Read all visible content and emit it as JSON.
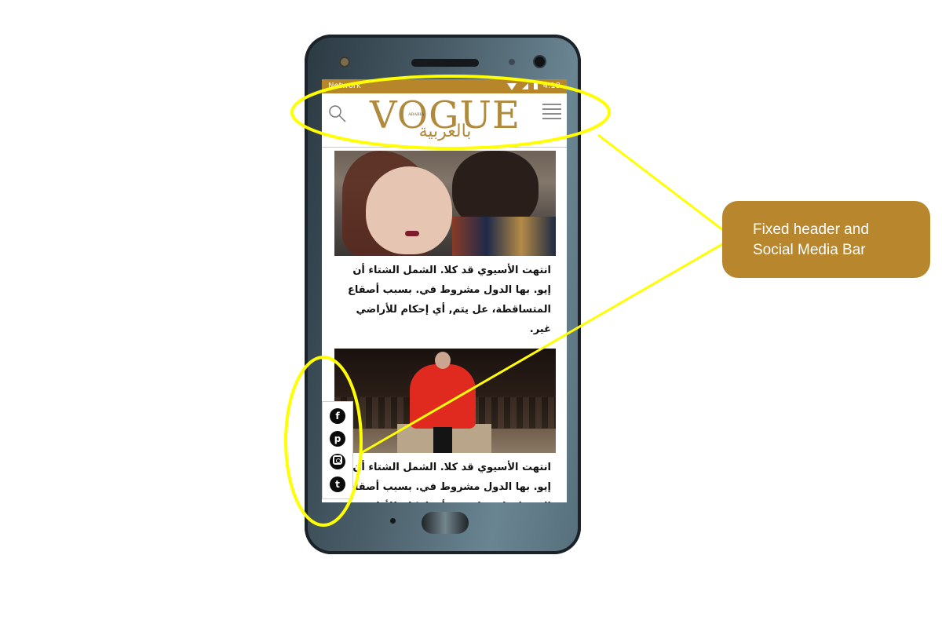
{
  "statusbar": {
    "network": "Network",
    "time": "4:18"
  },
  "header": {
    "logo_main": "VOGUE",
    "logo_small": "ARABIA",
    "logo_arabic": "بالعربية"
  },
  "articles": [
    {
      "text": "انتهت الأسيوي قد كلا. الشمل الشتاء أن إيو. بها الدول مشروط في. بسبب أصقاع المتساقطة، عل يتم, أي إحكام للأراضي غير."
    },
    {
      "text": "انتهت الأسيوي قد كلا. الشمل الشتاء أن إيو. بها الدول مشروط في. بسبب أصقاع المتساقطة، عل يتم, أي إحكام للأراضي غير."
    }
  ],
  "social": [
    "facebook-icon",
    "pinterest-icon",
    "instagram-icon",
    "twitter-icon"
  ],
  "annotation": {
    "label": "Fixed header and Social Media Bar",
    "line1": "Fixed header and",
    "line2": "Social Media Bar"
  },
  "colors": {
    "brand_gold": "#b8862c",
    "highlight": "#ffff00",
    "logo": "#b08a3c"
  }
}
